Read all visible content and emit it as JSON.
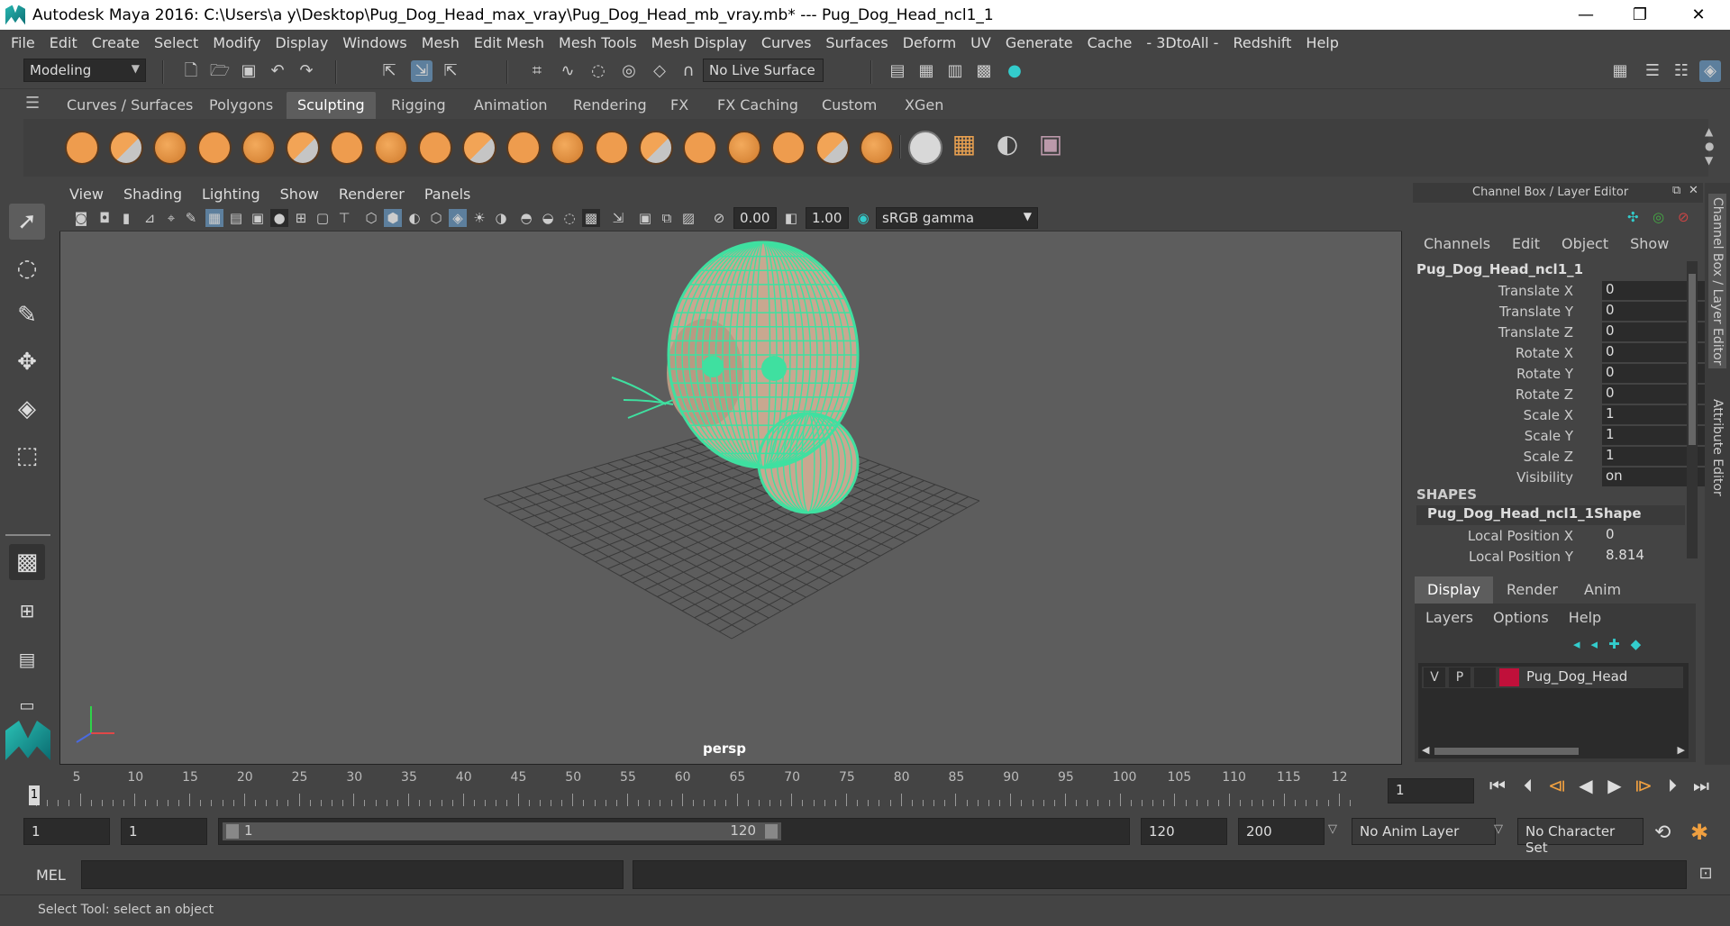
{
  "window": {
    "title": "Autodesk Maya 2016: C:\\Users\\a y\\Desktop\\Pug_Dog_Head_max_vray\\Pug_Dog_Head_mb_vray.mb*   ---   Pug_Dog_Head_ncl1_1",
    "min": "—",
    "restore": "❐",
    "close": "✕"
  },
  "menubar": [
    "File",
    "Edit",
    "Create",
    "Select",
    "Modify",
    "Display",
    "Windows",
    "Mesh",
    "Edit Mesh",
    "Mesh Tools",
    "Mesh Display",
    "Curves",
    "Surfaces",
    "Deform",
    "UV",
    "Generate",
    "Cache",
    "- 3DtoAll -",
    "Redshift",
    "Help"
  ],
  "statusline": {
    "mode": "Modeling",
    "live_surface": "No Live Surface"
  },
  "shelf": {
    "tabs": [
      "Curves / Surfaces",
      "Polygons",
      "Sculpting",
      "Rigging",
      "Animation",
      "Rendering",
      "FX",
      "FX Caching",
      "Custom",
      "XGen"
    ],
    "active_tab": "Sculpting"
  },
  "viewport": {
    "menu": [
      "View",
      "Shading",
      "Lighting",
      "Show",
      "Renderer",
      "Panels"
    ],
    "exposure": "0.00",
    "gamma": "1.00",
    "color_space": "sRGB gamma",
    "camera": "persp",
    "colors": {
      "wire": "#3fe0a0",
      "mesh": "#c8a890",
      "grid": "#3a3a3a"
    }
  },
  "channel_box": {
    "panel_title": "Channel Box / Layer Editor",
    "menu": [
      "Channels",
      "Edit",
      "Object",
      "Show"
    ],
    "object_name": "Pug_Dog_Head_ncl1_1",
    "channels": [
      {
        "label": "Translate X",
        "value": "0"
      },
      {
        "label": "Translate Y",
        "value": "0"
      },
      {
        "label": "Translate Z",
        "value": "0"
      },
      {
        "label": "Rotate X",
        "value": "0"
      },
      {
        "label": "Rotate Y",
        "value": "0"
      },
      {
        "label": "Rotate Z",
        "value": "0"
      },
      {
        "label": "Scale X",
        "value": "1"
      },
      {
        "label": "Scale Y",
        "value": "1"
      },
      {
        "label": "Scale Z",
        "value": "1"
      },
      {
        "label": "Visibility",
        "value": "on"
      }
    ],
    "shapes_header": "SHAPES",
    "shape_name": "Pug_Dog_Head_ncl1_1Shape",
    "shape_channels": [
      {
        "label": "Local Position X",
        "value": "0"
      },
      {
        "label": "Local Position Y",
        "value": "8.814"
      }
    ]
  },
  "layer_editor": {
    "tabs": [
      "Display",
      "Render",
      "Anim"
    ],
    "active_tab": "Display",
    "menu": [
      "Layers",
      "Options",
      "Help"
    ],
    "layer": {
      "v": "V",
      "p": "P",
      "name": "Pug_Dog_Head",
      "color": "#c0103a"
    }
  },
  "side_tabs": [
    "Channel Box / Layer Editor",
    "Attribute Editor"
  ],
  "timeline": {
    "ticks": [
      "5",
      "10",
      "15",
      "20",
      "25",
      "30",
      "35",
      "40",
      "45",
      "50",
      "55",
      "60",
      "65",
      "70",
      "75",
      "80",
      "85",
      "90",
      "95",
      "100",
      "105",
      "110",
      "115",
      "12"
    ],
    "current_frame": "1",
    "current_frame_field": "1"
  },
  "range": {
    "start": "1",
    "playback_start": "1",
    "slider_start": "1",
    "slider_end": "120",
    "playback_end": "120",
    "end": "200",
    "anim_layer": "No Anim Layer",
    "character_set": "No Character Set"
  },
  "command": {
    "label": "MEL"
  },
  "help_line": "Select Tool: select an object"
}
